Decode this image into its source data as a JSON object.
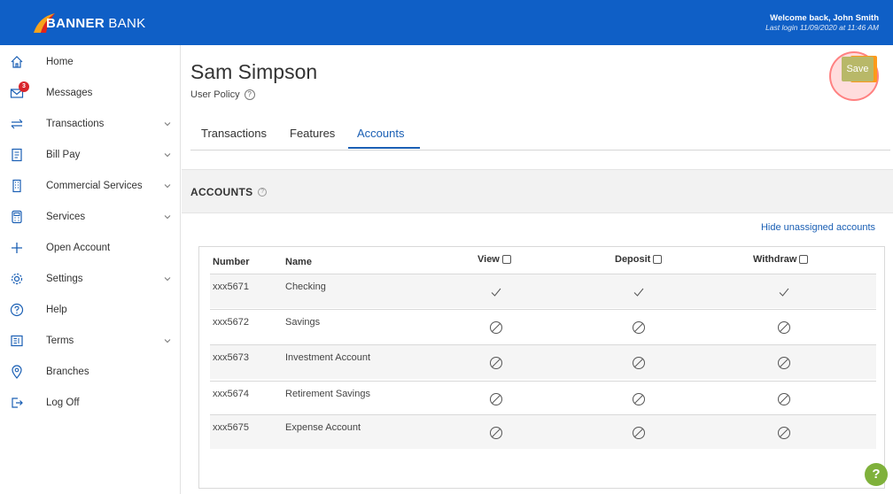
{
  "header": {
    "brand": "BANNER BANK",
    "welcome": "Welcome back, John Smith",
    "last_login": "Last login 11/09/2020 at 11:46 AM",
    "brand_color": "#0f5fc6"
  },
  "sidebar": {
    "items": [
      {
        "label": "Home",
        "icon": "home-icon",
        "has_chevron": false
      },
      {
        "label": "Messages",
        "icon": "envelope-icon",
        "has_chevron": false,
        "badge": "3"
      },
      {
        "label": "Transactions",
        "icon": "transfer-arrows-icon",
        "has_chevron": true
      },
      {
        "label": "Bill Pay",
        "icon": "bill-icon",
        "has_chevron": true
      },
      {
        "label": "Commercial Services",
        "icon": "building-icon",
        "has_chevron": true
      },
      {
        "label": "Services",
        "icon": "calculator-icon",
        "has_chevron": true
      },
      {
        "label": "Open Account",
        "icon": "plus-icon",
        "has_chevron": false
      },
      {
        "label": "Settings",
        "icon": "gear-icon",
        "has_chevron": true
      },
      {
        "label": "Help",
        "icon": "question-icon",
        "has_chevron": false
      },
      {
        "label": "Terms",
        "icon": "document-icon",
        "has_chevron": true
      },
      {
        "label": "Branches",
        "icon": "map-pin-icon",
        "has_chevron": false
      },
      {
        "label": "Log Off",
        "icon": "logout-icon",
        "has_chevron": false
      }
    ]
  },
  "main": {
    "title": "Sam Simpson",
    "subtitle": "User Policy",
    "help_glyph": "?",
    "save_label": "Save",
    "tabs": [
      {
        "label": "Transactions",
        "active": false
      },
      {
        "label": "Features",
        "active": false
      },
      {
        "label": "Accounts",
        "active": true
      }
    ],
    "section_title": "ACCOUNTS",
    "hide_link": "Hide unassigned accounts",
    "table": {
      "headers": {
        "number": "Number",
        "name": "Name",
        "view": "View",
        "deposit": "Deposit",
        "withdraw": "Withdraw"
      },
      "rows": [
        {
          "number": "xxx5671",
          "name": "Checking",
          "view": "check",
          "deposit": "check",
          "withdraw": "check"
        },
        {
          "number": "xxx5672",
          "name": "Savings",
          "view": "blocked",
          "deposit": "blocked",
          "withdraw": "blocked"
        },
        {
          "number": "xxx5673",
          "name": "Investment Account",
          "view": "blocked",
          "deposit": "blocked",
          "withdraw": "blocked"
        },
        {
          "number": "xxx5674",
          "name": "Retirement Savings",
          "view": "blocked",
          "deposit": "blocked",
          "withdraw": "blocked"
        },
        {
          "number": "xxx5675",
          "name": "Expense Account",
          "view": "blocked",
          "deposit": "blocked",
          "withdraw": "blocked"
        }
      ]
    }
  },
  "help_fab": "?"
}
